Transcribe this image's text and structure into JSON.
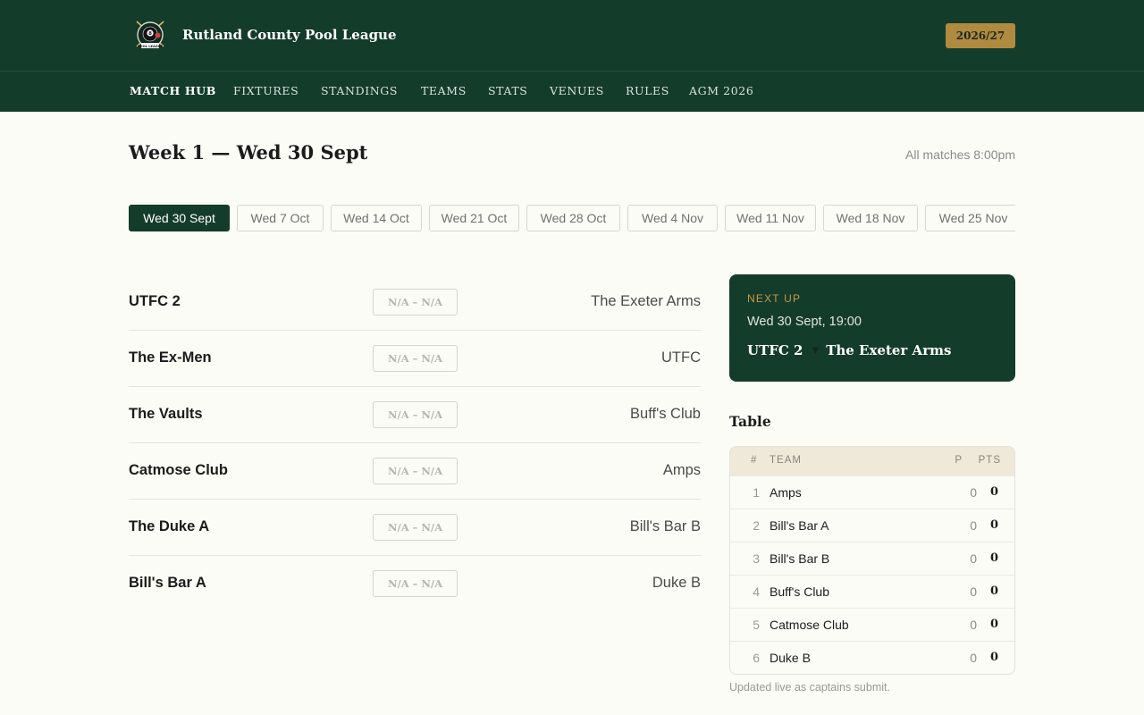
{
  "header": {
    "logo_icon": "pool-league-8-ball-logo",
    "logo_text": "POOL LEAGUE",
    "site_title": "Rutland County Pool League",
    "season": "2026/27"
  },
  "nav": {
    "items": [
      {
        "label": "Match Hub",
        "active": true
      },
      {
        "label": "Fixtures"
      },
      {
        "label": "Standings"
      },
      {
        "label": "Teams"
      },
      {
        "label": "Stats"
      },
      {
        "label": "Venues"
      },
      {
        "label": "Rules"
      },
      {
        "label": "AGM 2026"
      }
    ]
  },
  "main": {
    "title": "Week 1 — Wed 30 Sept",
    "time_note": "All matches 8:00pm",
    "weeks": [
      "Wed 30 Sept",
      "Wed 7 Oct",
      "Wed 14 Oct",
      "Wed 21 Oct",
      "Wed 28 Oct",
      "Wed 4 Nov",
      "Wed 11 Nov",
      "Wed 18 Nov",
      "Wed 25 Nov"
    ],
    "active_week": "Wed 30 Sept",
    "fixtures": [
      {
        "home": "UTFC 2",
        "score": "N/A – N/A",
        "away": "The Exeter Arms"
      },
      {
        "home": "The Ex-Men",
        "score": "N/A – N/A",
        "away": "UTFC"
      },
      {
        "home": "The Vaults",
        "score": "N/A – N/A",
        "away": "Buff's Club"
      },
      {
        "home": "Catmose Club",
        "score": "N/A – N/A",
        "away": "Amps"
      },
      {
        "home": "The Duke A",
        "score": "N/A – N/A",
        "away": "Bill's Bar B"
      },
      {
        "home": "Bill's Bar A",
        "score": "N/A – N/A",
        "away": "Duke B"
      }
    ]
  },
  "next_up": {
    "kicker": "NEXT UP",
    "when": "Wed 30 Sept, 19:00",
    "home": "UTFC 2",
    "vs_icon": "chevron-down-icon",
    "away": "The Exeter Arms"
  },
  "table": {
    "title": "Table",
    "headers": {
      "pos": "#",
      "team": "TEAM",
      "played": "P",
      "pts": "PTS"
    },
    "rows": [
      {
        "pos": "1",
        "team": "Amps",
        "played": "0",
        "pts": "0"
      },
      {
        "pos": "2",
        "team": "Bill's Bar A",
        "played": "0",
        "pts": "0"
      },
      {
        "pos": "3",
        "team": "Bill's Bar B",
        "played": "0",
        "pts": "0"
      },
      {
        "pos": "4",
        "team": "Buff's Club",
        "played": "0",
        "pts": "0"
      },
      {
        "pos": "5",
        "team": "Catmose Club",
        "played": "0",
        "pts": "0"
      },
      {
        "pos": "6",
        "team": "Duke B",
        "played": "0",
        "pts": "0"
      }
    ],
    "footnote": "Updated live as captains submit."
  },
  "colors": {
    "brand_green": "#143c2b",
    "accent_gold": "#b08a3e",
    "page_bg": "#fcfcf7"
  }
}
